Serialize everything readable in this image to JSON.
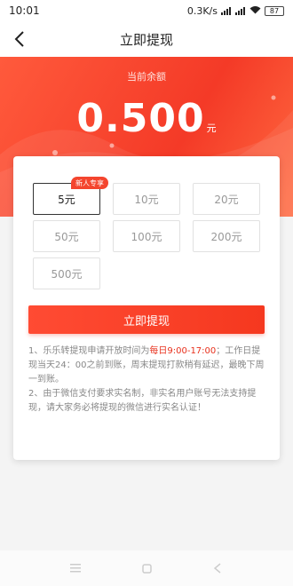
{
  "status_bar": {
    "time": "10:01",
    "network_speed": "0.3K/s",
    "battery": "87",
    "signal_icon": "signal-icon",
    "wifi_icon": "wifi-icon"
  },
  "navbar": {
    "title": "立即提现",
    "back_icon": "chevron-left-icon"
  },
  "balance": {
    "label": "当前余额",
    "amount": "0.500",
    "unit": "元"
  },
  "options": [
    {
      "label": "5元",
      "selected": true,
      "badge": "新人专享"
    },
    {
      "label": "10元"
    },
    {
      "label": "20元"
    },
    {
      "label": "50元"
    },
    {
      "label": "100元"
    },
    {
      "label": "200元"
    },
    {
      "label": "500元"
    }
  ],
  "submit_label": "立即提现",
  "notes": {
    "p1_a": "1、乐乐转提现申请开放时间为",
    "p1_highlight": "每日9:00-17:00",
    "p1_b": "；工作日提现当天24：00之前到账，周末提现打款稍有延迟，最晚下周一到账。",
    "p2": "2、由于微信支付要求实名制，非实名用户账号无法支持提现，请大家务必将提现的微信进行实名认证！"
  },
  "colors": {
    "accent": "#f43a27",
    "highlight": "#e8301c"
  },
  "bottom_nav": {
    "menu_icon": "menu-icon",
    "home_icon": "square-home-icon",
    "back_icon": "triangle-back-icon"
  }
}
